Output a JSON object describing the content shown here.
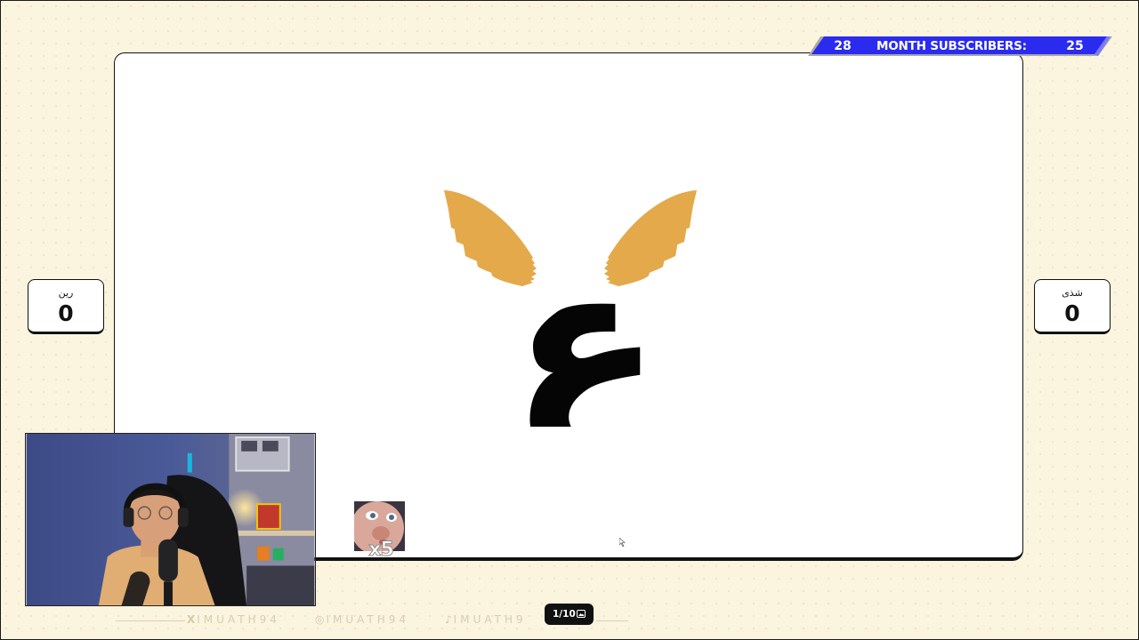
{
  "subscribers_banner": {
    "left_count": "28",
    "label": "MONTH SUBSCRIBERS:",
    "right_count": "25",
    "color": "#2b2bf0"
  },
  "scores": {
    "left": {
      "name": "رين",
      "value": "0"
    },
    "right": {
      "name": "شذى",
      "value": "0"
    }
  },
  "stage": {
    "letter": "ع",
    "wing_color": "#e4a94a"
  },
  "emote": {
    "count": "x5"
  },
  "social": {
    "handles": [
      "IMUATH94",
      "IMUATH94",
      "IMUATH9"
    ],
    "icons": [
      "x-icon",
      "instagram-icon",
      "tiktok-icon"
    ]
  },
  "pagination": {
    "label": "1/10"
  }
}
